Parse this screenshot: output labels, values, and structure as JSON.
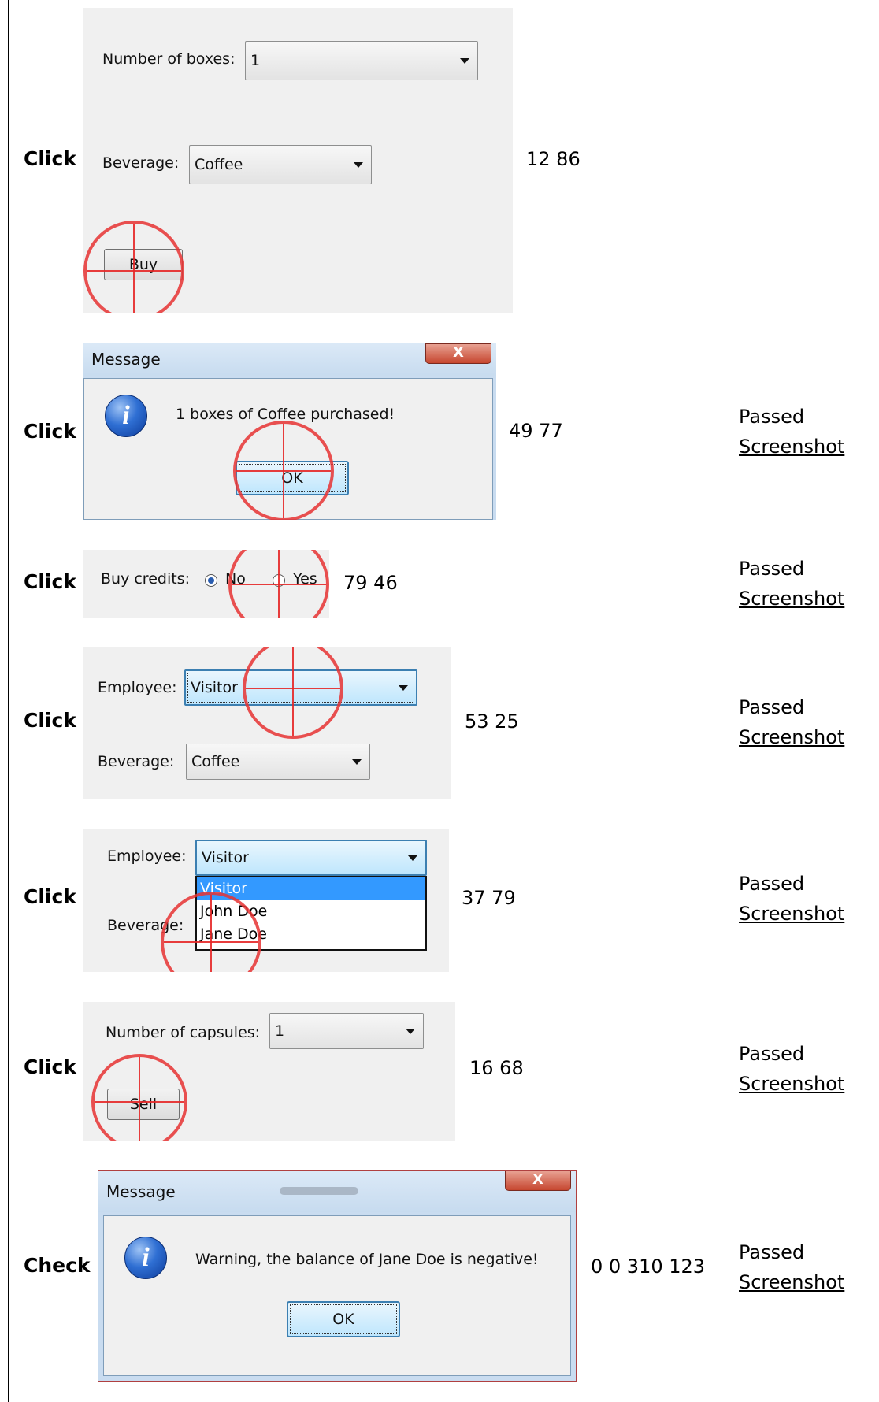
{
  "rows": [
    {
      "action": "Click",
      "coords": "12 86",
      "status": "",
      "link": "",
      "ui": {
        "boxes_label": "Number of boxes:",
        "boxes_value": "1",
        "beverage_label": "Beverage:",
        "beverage_value": "Coffee",
        "buy_button": "Buy"
      }
    },
    {
      "action": "Click",
      "coords": "49 77",
      "status": "Passed",
      "link": "Screenshot",
      "ui": {
        "title": "Message",
        "close_glyph": "X",
        "message": "1 boxes of Coffee purchased!",
        "ok_button": "OK"
      }
    },
    {
      "action": "Click",
      "coords": "79 46",
      "status": "Passed",
      "link": "Screenshot",
      "ui": {
        "credits_label": "Buy credits:",
        "no_label": "No",
        "yes_label": "Yes"
      }
    },
    {
      "action": "Click",
      "coords": "53 25",
      "status": "Passed",
      "link": "Screenshot",
      "ui": {
        "employee_label": "Employee:",
        "employee_value": "Visitor",
        "beverage_label": "Beverage:",
        "beverage_value": "Coffee"
      }
    },
    {
      "action": "Click",
      "coords": "37 79",
      "status": "Passed",
      "link": "Screenshot",
      "ui": {
        "employee_label": "Employee:",
        "employee_value": "Visitor",
        "beverage_label": "Beverage:",
        "options": [
          "Visitor",
          "John Doe",
          "Jane Doe"
        ]
      }
    },
    {
      "action": "Click",
      "coords": "16 68",
      "status": "Passed",
      "link": "Screenshot",
      "ui": {
        "capsules_label": "Number of capsules:",
        "capsules_value": "1",
        "sell_button": "Sell"
      }
    },
    {
      "action": "Check",
      "coords": "0 0 310 123",
      "status": "Passed",
      "link": "Screenshot",
      "ui": {
        "title": "Message",
        "close_glyph": "X",
        "message": "Warning, the balance of Jane Doe is negative!",
        "ok_button": "OK"
      }
    }
  ]
}
